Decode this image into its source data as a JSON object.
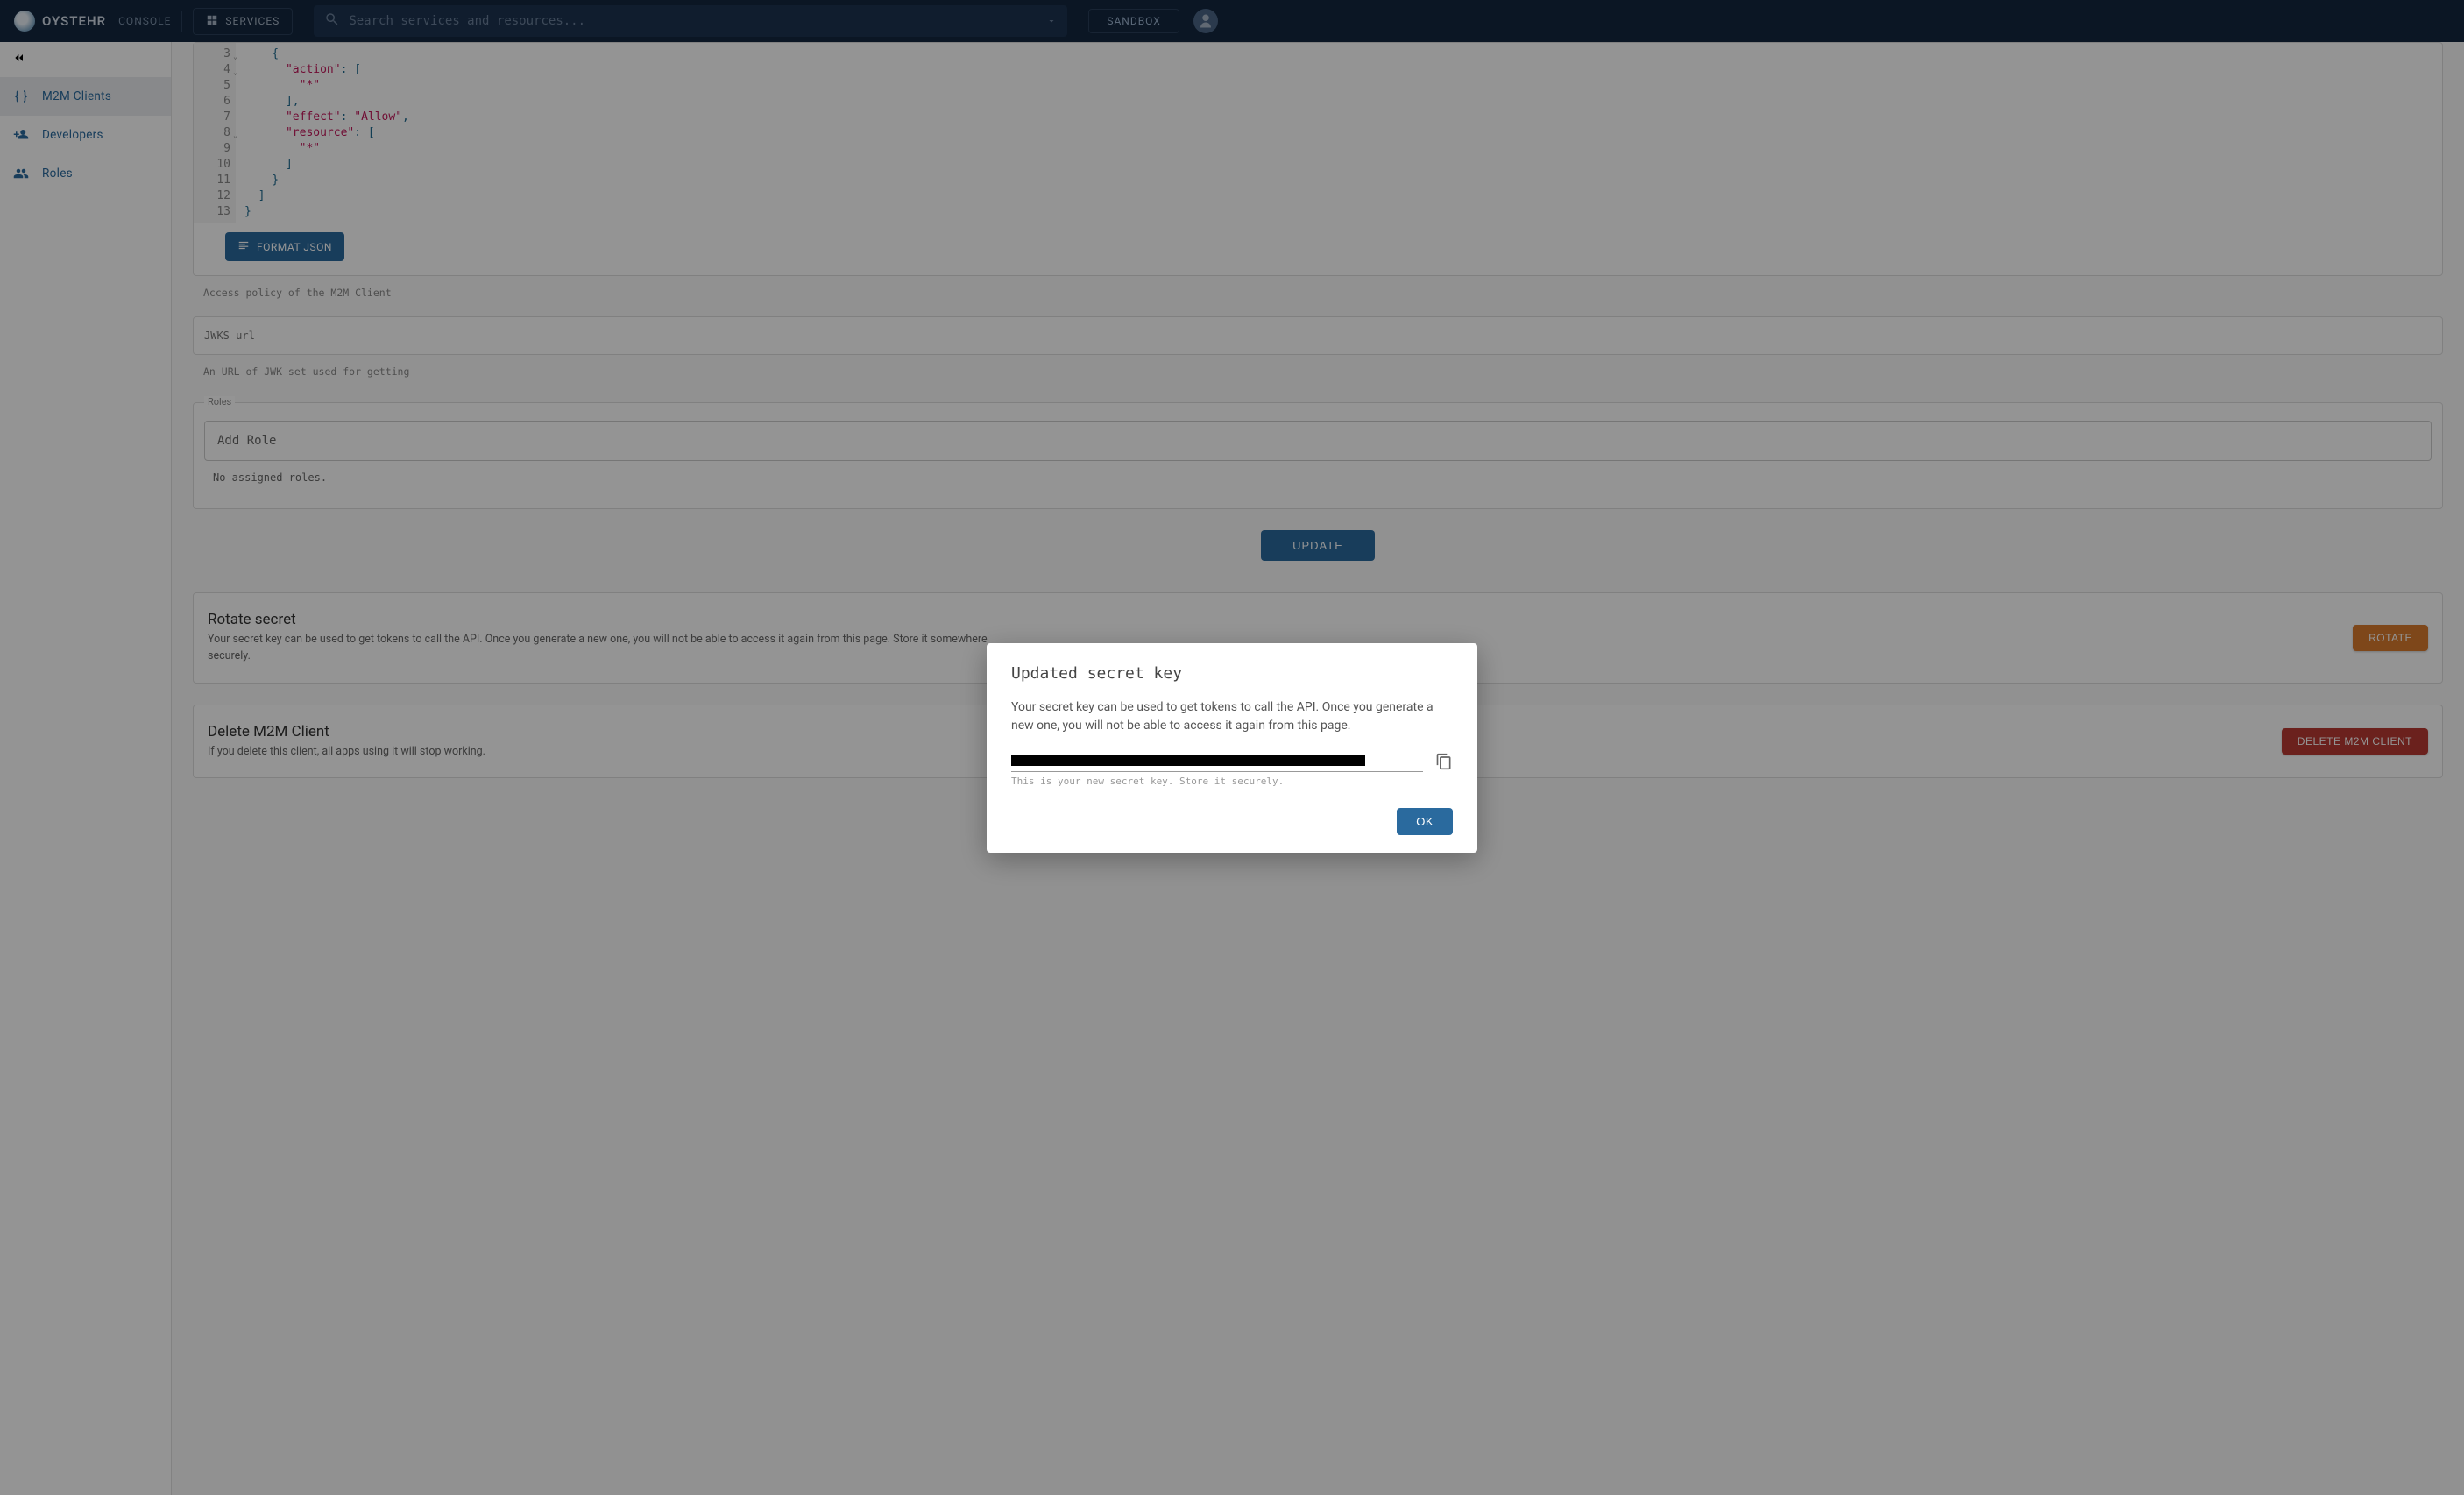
{
  "header": {
    "brand": "OYSTEHR",
    "console": "CONSOLE",
    "services": "SERVICES",
    "search_placeholder": "Search services and resources...",
    "sandbox": "SANDBOX"
  },
  "sidebar": {
    "items": [
      {
        "label": "M2M Clients",
        "icon": "braces-icon",
        "active": true
      },
      {
        "label": "Developers",
        "icon": "person-add-icon",
        "active": false
      },
      {
        "label": "Roles",
        "icon": "group-icon",
        "active": false
      }
    ]
  },
  "policy": {
    "code_lines": [
      {
        "n": "3",
        "fold": true,
        "text": "    {"
      },
      {
        "n": "4",
        "fold": true,
        "text": "      \"action\": ["
      },
      {
        "n": "5",
        "fold": false,
        "text": "        \"*\""
      },
      {
        "n": "6",
        "fold": false,
        "text": "      ],"
      },
      {
        "n": "7",
        "fold": false,
        "text": "      \"effect\": \"Allow\","
      },
      {
        "n": "8",
        "fold": true,
        "text": "      \"resource\": ["
      },
      {
        "n": "9",
        "fold": false,
        "text": "        \"*\""
      },
      {
        "n": "10",
        "fold": false,
        "text": "      ]"
      },
      {
        "n": "11",
        "fold": false,
        "text": "    }"
      },
      {
        "n": "12",
        "fold": false,
        "text": "  ]"
      },
      {
        "n": "13",
        "fold": false,
        "text": "}"
      }
    ],
    "format_btn": "FORMAT JSON",
    "helper": "Access policy of the M2M Client"
  },
  "jwks": {
    "label": "JWKS url",
    "helper": "An URL of JWK set used for getting"
  },
  "roles": {
    "legend": "Roles",
    "placeholder": "Add Role",
    "empty": "No assigned roles."
  },
  "update_btn": "UPDATE",
  "rotate": {
    "title": "Rotate secret",
    "desc": "Your secret key can be used to get tokens to call the API. Once you generate a new one, you will not be able to access it again from this page. Store it somewhere securely.",
    "btn": "ROTATE"
  },
  "delete": {
    "title": "Delete M2M Client",
    "desc": "If you delete this client, all apps using it will stop working.",
    "btn": "DELETE M2M CLIENT"
  },
  "modal": {
    "title": "Updated secret key",
    "desc": "Your secret key can be used to get tokens to call the API. Once you generate a new one, you will not be able to access it again from this page.",
    "helper": "This is your new secret key. Store it securely.",
    "ok": "OK"
  }
}
